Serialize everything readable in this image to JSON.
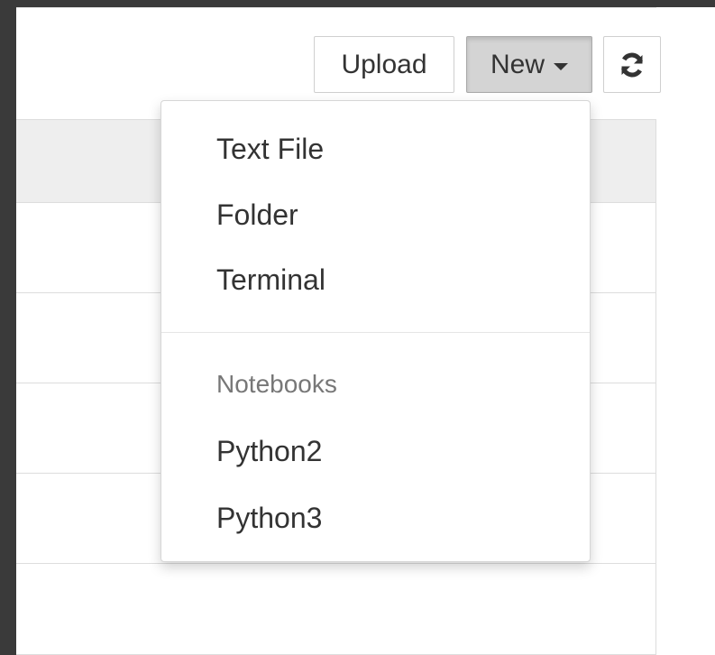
{
  "toolbar": {
    "upload_label": "Upload",
    "new_label": "New",
    "refresh_icon": "refresh-icon"
  },
  "new_menu": {
    "items": [
      {
        "label": "Text File"
      },
      {
        "label": "Folder"
      },
      {
        "label": "Terminal"
      }
    ],
    "section_header": "Notebooks",
    "notebooks": [
      {
        "label": "Python2"
      },
      {
        "label": "Python3"
      }
    ]
  },
  "colors": {
    "active_button_bg": "#d4d4d4",
    "header_row_bg": "#eeeeee",
    "backdrop": "#3a3a3a"
  }
}
